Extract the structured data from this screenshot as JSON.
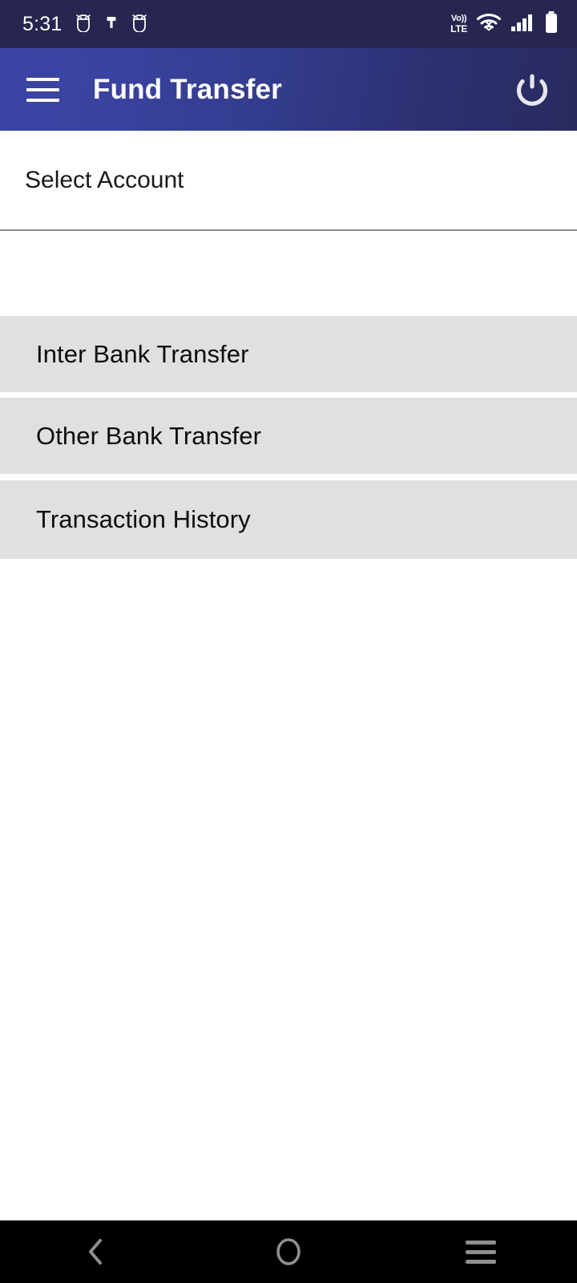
{
  "status_bar": {
    "time": "5:31",
    "notification_icons": [
      "android-robot-icon",
      "usb-plug-icon",
      "android-robot-icon"
    ],
    "volte": {
      "top": "Vo))",
      "bottom": "LTE"
    },
    "right_icons": [
      "volte-icon",
      "wifi-icon",
      "cellular-signal-icon",
      "battery-icon"
    ],
    "background_color": "#262650",
    "foreground_color": "#ffffff"
  },
  "header": {
    "menu_icon": "hamburger-menu-icon",
    "title": "Fund Transfer",
    "power_icon": "power-logout-icon",
    "gradient_start": "#3c45a4",
    "gradient_end": "#2a2a5e",
    "text_color": "#ffffff"
  },
  "form": {
    "account_selector": {
      "label": "Select Account",
      "value": "",
      "placeholder": "Select Account",
      "underline_color": "#8c8c8c"
    }
  },
  "menu": {
    "row_background": "#e0e0e0",
    "items": [
      {
        "label": "Inter Bank Transfer"
      },
      {
        "label": "Other Bank Transfer"
      },
      {
        "label": "Transaction History"
      }
    ]
  },
  "nav_bar": {
    "background_color": "#000000",
    "icon_color": "#8f8f8f",
    "buttons": [
      {
        "name": "back-icon"
      },
      {
        "name": "home-icon"
      },
      {
        "name": "recent-apps-icon"
      }
    ]
  }
}
